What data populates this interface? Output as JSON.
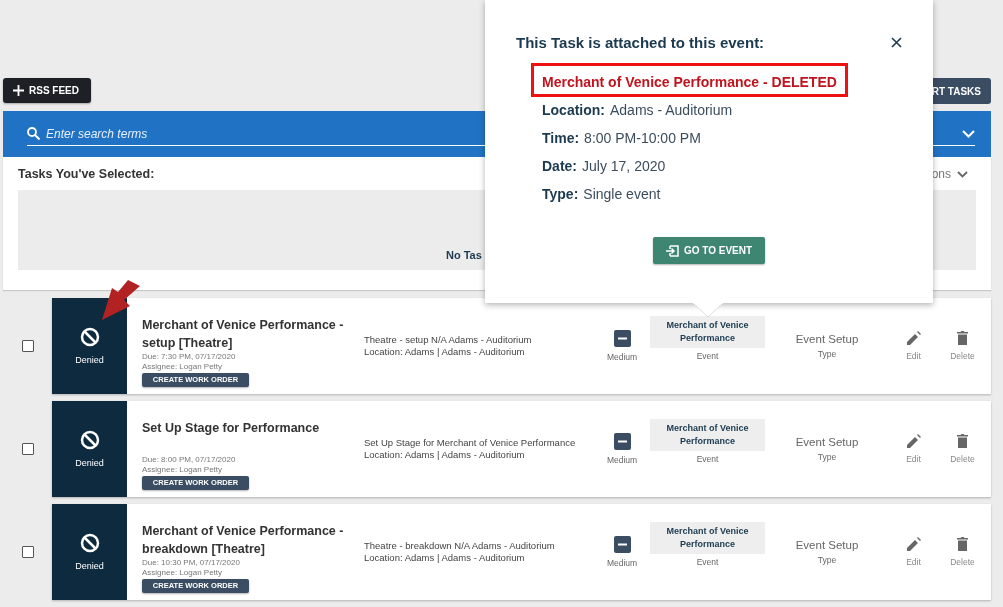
{
  "toolbar": {
    "rss_button": "RSS FEED",
    "right_button": "RT TASKS"
  },
  "search": {
    "placeholder": "Enter search terms"
  },
  "selected_panel": {
    "title": "Tasks You've Selected:",
    "options_label": "ons",
    "empty_text": "No Tas"
  },
  "tasks": [
    {
      "checked": false,
      "status": "Denied",
      "title": "Merchant of Venice Performance - setup [Theatre]",
      "due": "Due: 7:30 PM, 07/17/2020",
      "assignee": "Assignee: Logan Petty",
      "work_order_button": "CREATE WORK ORDER",
      "description": "Theatre - setup N/A Adams - Auditorium",
      "location": "Location: Adams | Adams - Auditorium",
      "priority": "Medium",
      "event": "Merchant of Venice Performance",
      "event_label": "Event",
      "type": "Event Setup",
      "type_label": "Type",
      "edit": "Edit",
      "delete": "Delete"
    },
    {
      "checked": false,
      "status": "Denied",
      "title": "Set Up Stage for Performance",
      "due": "Due: 8:00 PM, 07/17/2020",
      "assignee": "Assignee: Logan Petty",
      "work_order_button": "CREATE WORK ORDER",
      "description": "Set Up Stage for Merchant of Venice Performance",
      "location": "Location: Adams | Adams - Auditorium",
      "priority": "Medium",
      "event": "Merchant of Venice Performance",
      "event_label": "Event",
      "type": "Event Setup",
      "type_label": "Type",
      "edit": "Edit",
      "delete": "Delete"
    },
    {
      "checked": false,
      "status": "Denied",
      "title": "Merchant of Venice Performance - breakdown [Theatre]",
      "due": "Due: 10:30 PM, 07/17/2020",
      "assignee": "Assignee: Logan Petty",
      "work_order_button": "CREATE WORK ORDER",
      "description": "Theatre - breakdown N/A Adams - Auditorium",
      "location": "Location: Adams | Adams - Auditorium",
      "priority": "Medium",
      "event": "Merchant of Venice Performance",
      "event_label": "Event",
      "type": "Event Setup",
      "type_label": "Type",
      "edit": "Edit",
      "delete": "Delete"
    }
  ],
  "popover": {
    "title": "This Task is attached to this event:",
    "event_name": "Merchant of Venice Performance - DELETED",
    "fields": [
      {
        "label": "Location:",
        "value": "Adams - Auditorium"
      },
      {
        "label": "Time:",
        "value": "8:00 PM-10:00 PM"
      },
      {
        "label": "Date:",
        "value": "July 17, 2020"
      },
      {
        "label": "Type:",
        "value": "Single event"
      }
    ],
    "button": "GO TO EVENT"
  }
}
